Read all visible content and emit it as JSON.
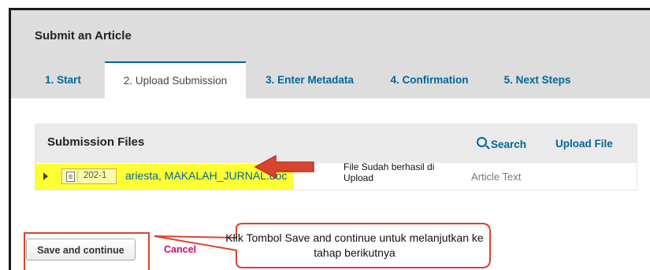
{
  "page": {
    "title": "Submit an Article"
  },
  "tabs": [
    {
      "label": "1. Start"
    },
    {
      "label": "2. Upload Submission"
    },
    {
      "label": "3. Enter Metadata"
    },
    {
      "label": "4. Confirmation"
    },
    {
      "label": "5. Next Steps"
    }
  ],
  "active_tab": "2. Upload Submission",
  "submission_files": {
    "title": "Submission Files",
    "search_label": "Search",
    "upload_label": "Upload File",
    "files": [
      {
        "id": "202-1",
        "name": "ariesta, MAKALAH_JURNAL.doc",
        "genre": "Article Text",
        "icon": "doc-icon"
      }
    ]
  },
  "annotations": {
    "upload_note": "File Sudah berhasil di Upload",
    "callout": "Klik Tombol Save and continue untuk melanjutkan ke tahap berikutnya"
  },
  "actions": {
    "save_label": "Save and continue",
    "cancel_label": "Cancel"
  },
  "colors": {
    "link_blue": "#006798",
    "highlight_yellow": "#ffff33",
    "annotation_red": "#d9442e",
    "cancel_pink": "#d00a6c"
  }
}
